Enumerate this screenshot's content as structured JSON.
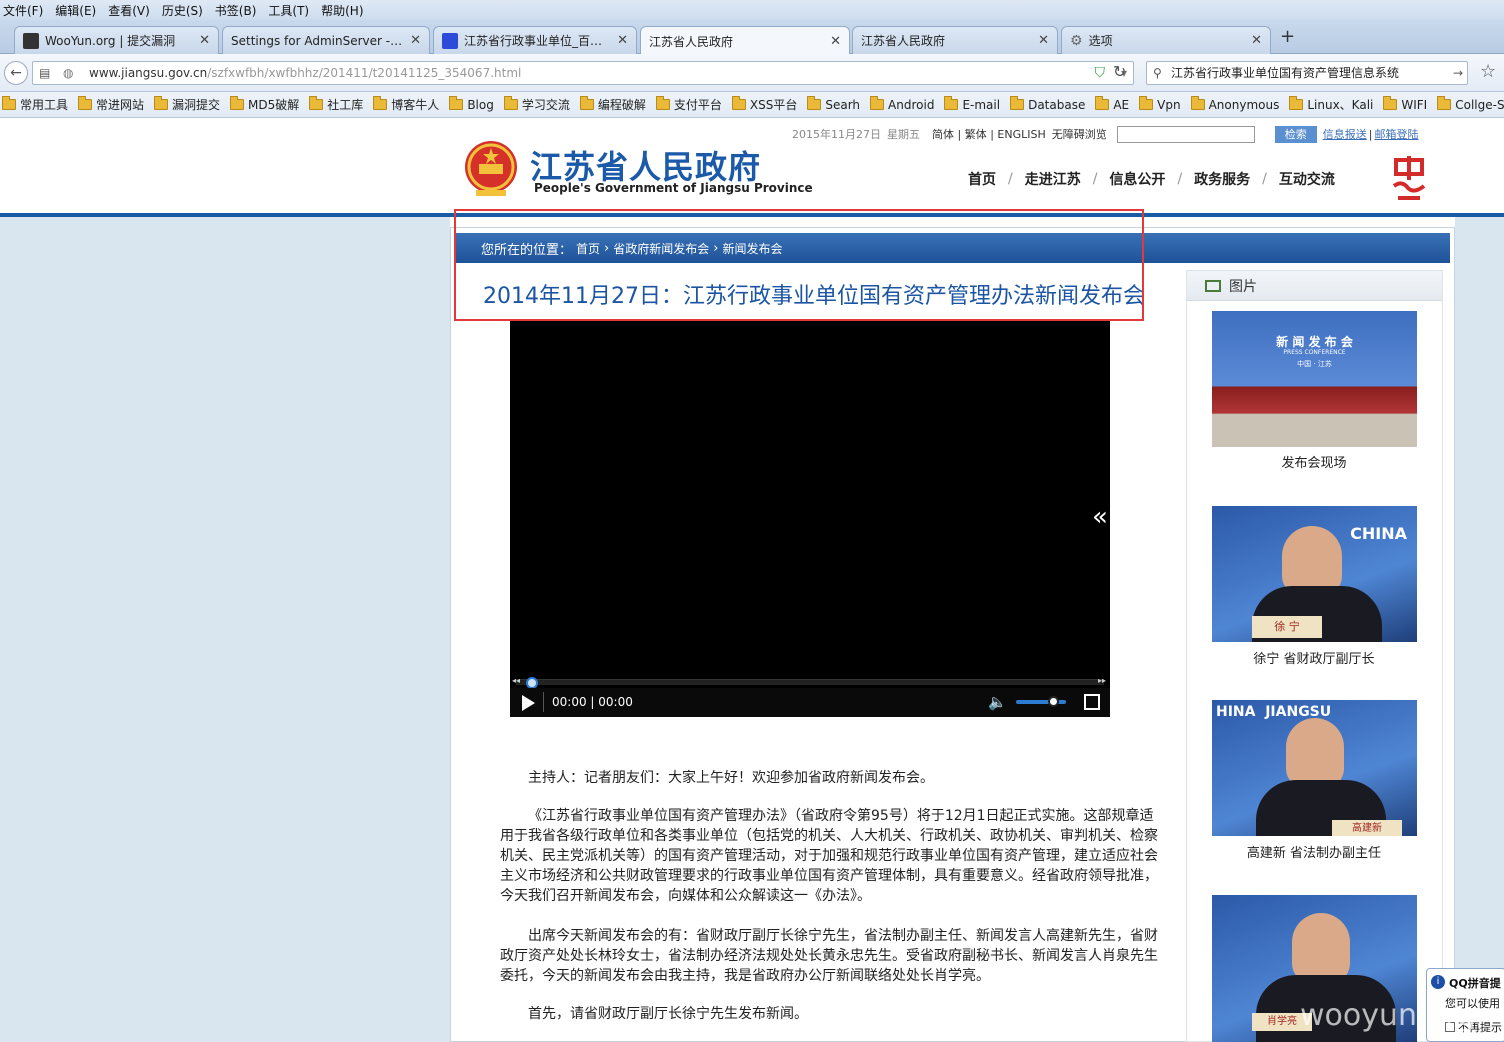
{
  "menubar": [
    "文件(F)",
    "编辑(E)",
    "查看(V)",
    "历史(S)",
    "书签(B)",
    "工具(T)",
    "帮助(H)"
  ],
  "tabs": [
    {
      "label": "WooYun.org | 提交漏洞",
      "active": false
    },
    {
      "label": "Settings for AdminServer - hjzc...",
      "active": false
    },
    {
      "label": "江苏省行政事业单位_百度...",
      "active": false
    },
    {
      "label": "江苏省人民政府",
      "active": true
    },
    {
      "label": "江苏省人民政府",
      "active": false
    },
    {
      "label": "选项",
      "active": false
    }
  ],
  "url": {
    "domain": "www.jiangsu.gov.cn",
    "path": "/szfxwfbh/xwfbhhz/201411/t20141125_354067.html"
  },
  "browser_search": "江苏省行政事业单位国有资产管理信息系统",
  "bookmarks": [
    "常用工具",
    "常进网站",
    "漏洞提交",
    "MD5破解",
    "社工库",
    "博客牛人",
    "Blog",
    "学习交流",
    "编程破解",
    "支付平台",
    "XSS平台",
    "Searh",
    "Android",
    "E-mail",
    "Database",
    "AE",
    "Vpn",
    "Anonymous",
    "Linux、Kali",
    "WIFI",
    "Collge-School",
    "团队"
  ],
  "util": {
    "date": "2015年11月27日",
    "weekday": "星期五",
    "lang": "简体 | 繁体 | ENGLISH",
    "access": "无障碍浏览",
    "search_btn": "检索",
    "link1": "信息报送",
    "link2": "邮箱登陆"
  },
  "site": {
    "title": "江苏省人民政府",
    "subtitle": "People's Government of Jiangsu Province"
  },
  "nav": [
    "首页",
    "走进江苏",
    "信息公开",
    "政务服务",
    "互动交流"
  ],
  "breadcrumb": {
    "prefix": "您所在的位置：",
    "items": [
      "首页",
      "省政府新闻发布会",
      "新闻发布会"
    ]
  },
  "article": {
    "title": "2014年11月27日：江苏行政事业单位国有资产管理办法新闻发布会",
    "video_time": "00:00 | 00:00",
    "video_progress": 0,
    "volume": 0.75,
    "paragraphs": [
      "主持人：记者朋友们：大家上午好！欢迎参加省政府新闻发布会。",
      "《江苏省行政事业单位国有资产管理办法》（省政府令第95号）将于12月1日起正式实施。这部规章适用于我省各级行政单位和各类事业单位（包括党的机关、人大机关、行政机关、政协机关、审判机关、检察机关、民主党派机关等）的国有资产管理活动，对于加强和规范行政事业单位国有资产管理，建立适应社会主义市场经济和公共财政管理要求的行政事业单位国有资产管理体制，具有重要意义。经省政府领导批准，今天我们召开新闻发布会，向媒体和公众解读这一《办法》。",
      "出席今天新闻发布会的有：省财政厅副厅长徐宁先生，省法制办副主任、新闻发言人高建新先生，省财政厅资产处处长林玲女士，省法制办经济法规处处长黄永忠先生。受省政府副秘书长、新闻发言人肖泉先生委托，今天的新闻发布会由我主持，我是省政府办公厅新闻联络处处长肖学亮。",
      "首先，请省财政厅副厅长徐宁先生发布新闻。"
    ]
  },
  "sidebar": {
    "heading": "图片",
    "photos": [
      {
        "caption": "发布会现场",
        "banner": "新 闻 发 布 会",
        "banner_sub": "PRESS CONFERENCE",
        "banner_loc": "中国 · 江苏"
      },
      {
        "caption": "徐宁 省财政厅副厅长",
        "bg_text": "CHINA",
        "nameplate": "徐 宁"
      },
      {
        "caption": "高建新 省法制办副主任",
        "bg_text": "HINA  JIANGSU",
        "nameplate": "高建新"
      },
      {
        "caption": "",
        "nameplate": "肖学亮"
      }
    ]
  },
  "qq_popup": {
    "title": "QQ拼音提",
    "body": "您可以使用",
    "check": "不再提示"
  },
  "watermark": "wooyun.org"
}
